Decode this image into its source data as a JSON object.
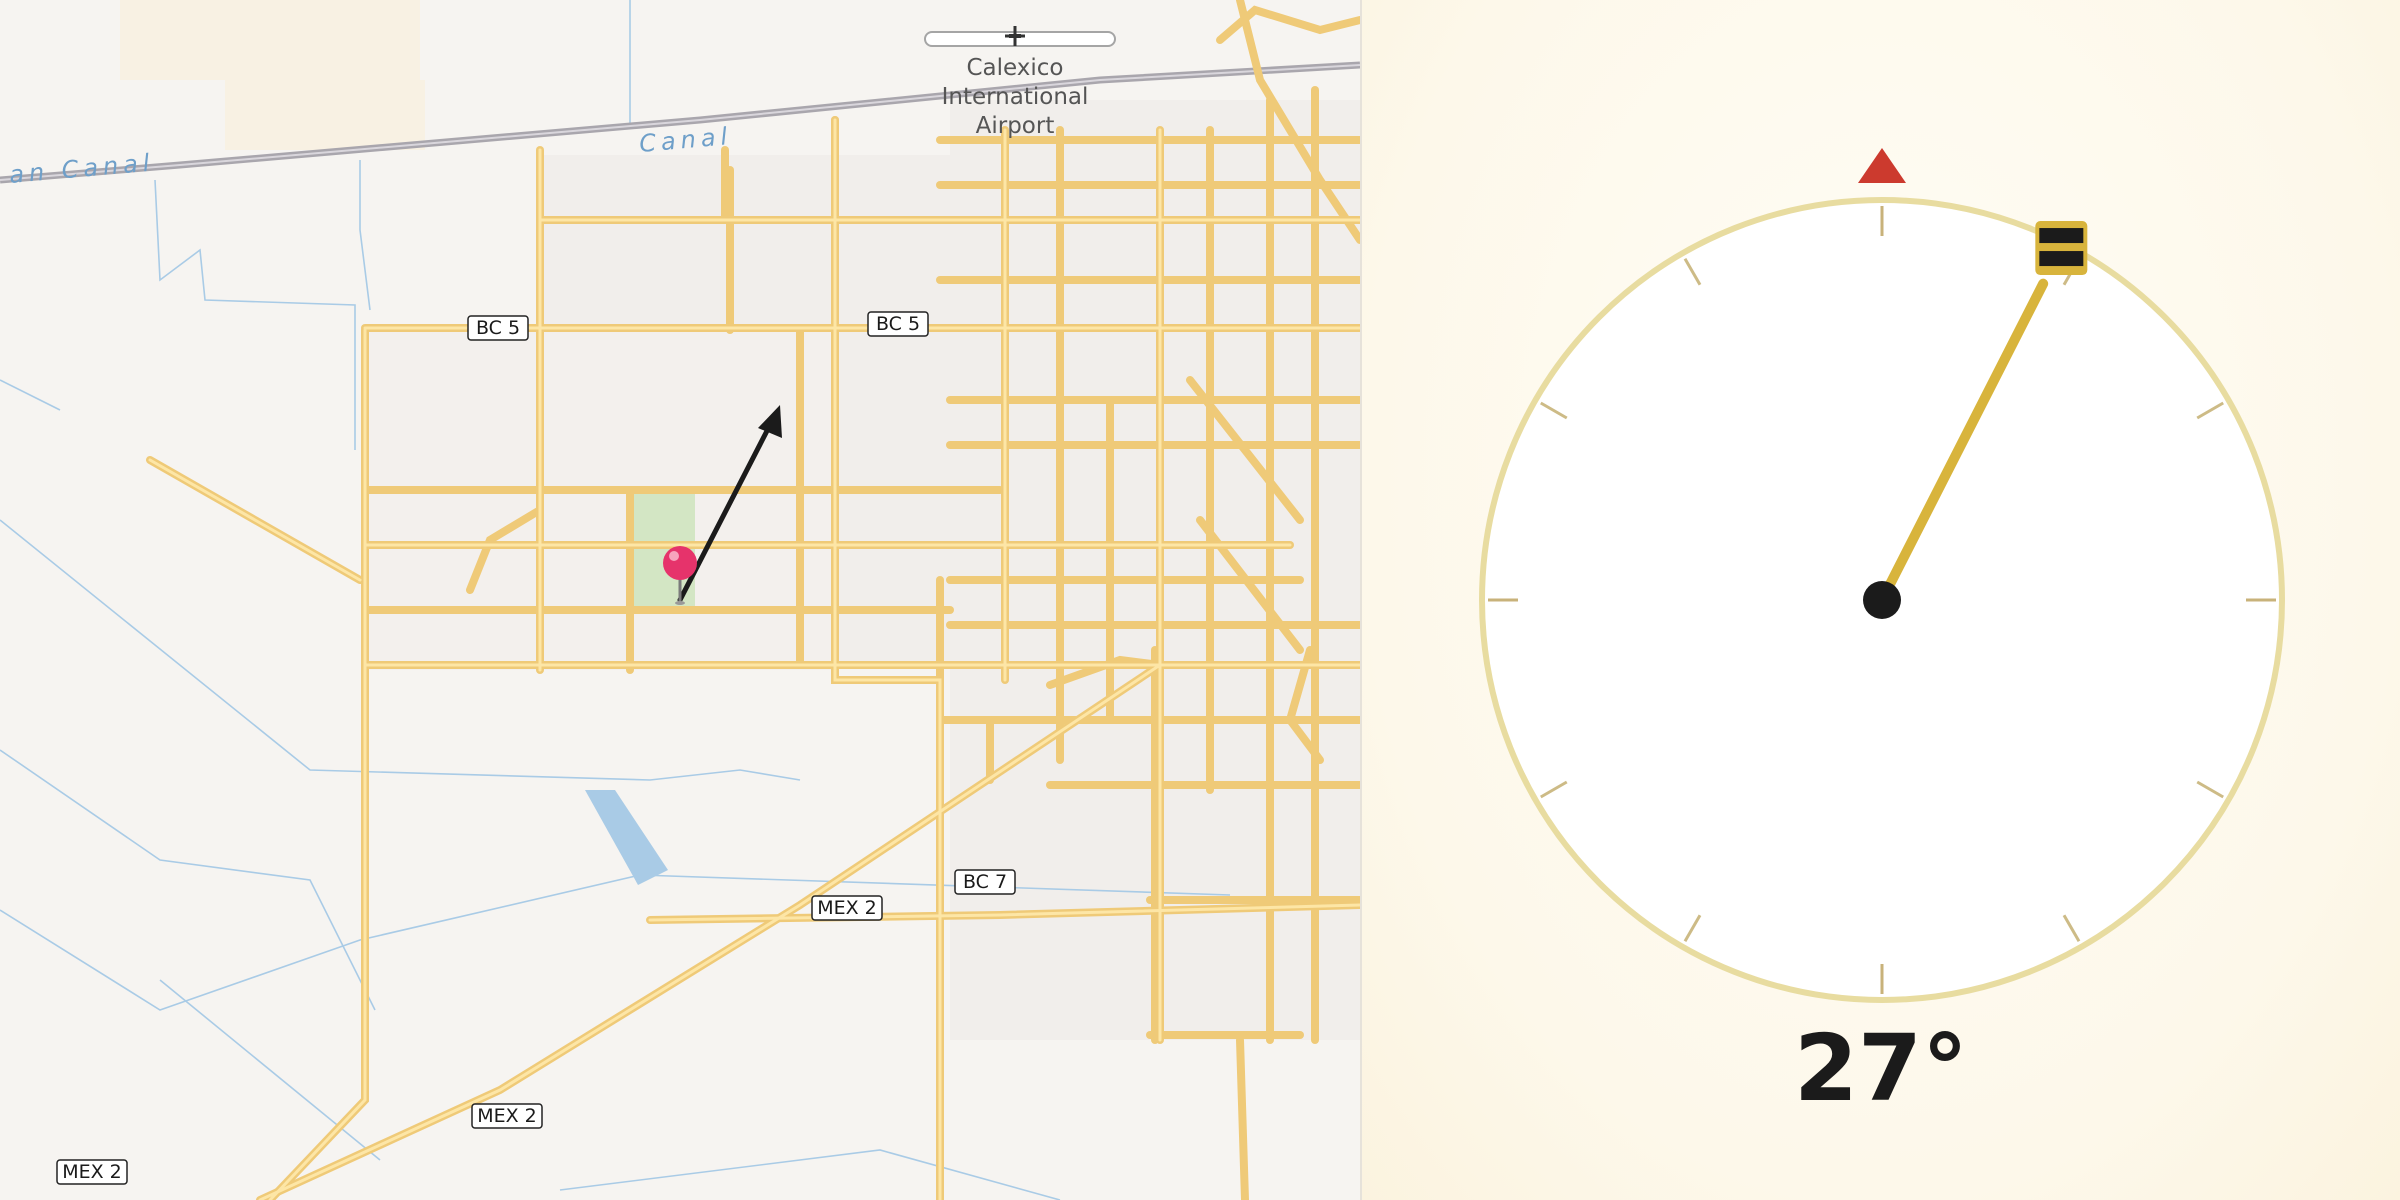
{
  "map": {
    "airport_label": [
      "Calexico",
      "International",
      "Airport"
    ],
    "water_labels": [
      "an Canal",
      "Canal"
    ],
    "road_shields": [
      "BC 5",
      "BC 5",
      "BC 7",
      "MEX 2",
      "MEX 2",
      "MEX 2"
    ],
    "pin_icon": "map-pin-icon",
    "direction_arrow_icon": "direction-arrow-icon",
    "airport_icon": "airplane-icon",
    "colors": {
      "road": "#f7d98a",
      "water": "#a9cbe6",
      "rail": "#a9a6ad",
      "pin": "#e6336b",
      "park": "#d3e6c4"
    }
  },
  "compass": {
    "heading_deg": 27,
    "heading_text": "27°",
    "north_marker_icon": "north-triangle-icon",
    "handle_icon": "needle-handle-icon",
    "colors": {
      "ring": "#e8dca0",
      "needle": "#d8b43c",
      "north": "#cc3a2e",
      "hub": "#1b1b1b"
    }
  }
}
